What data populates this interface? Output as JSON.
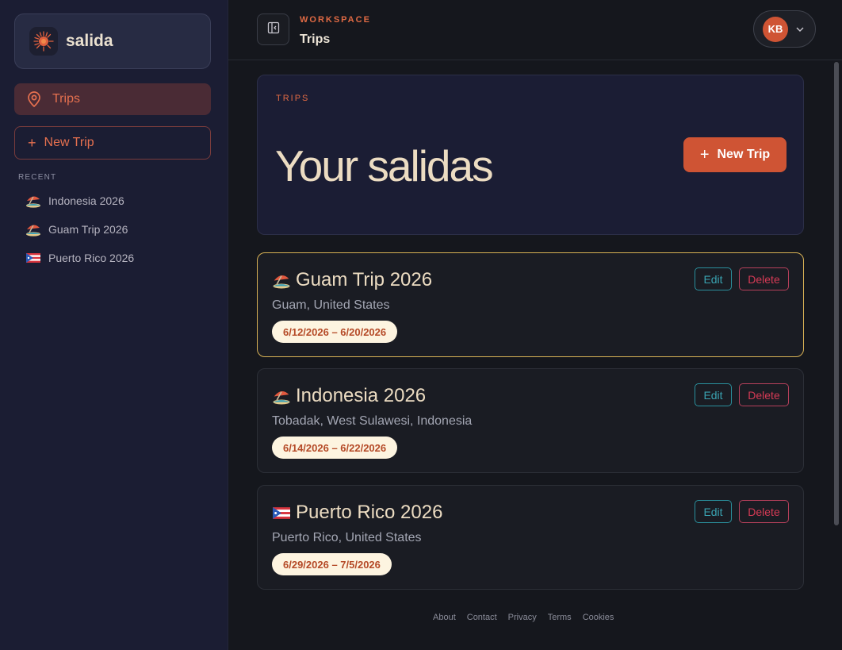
{
  "brand": {
    "name": "salida"
  },
  "sidebar": {
    "nav_trips_label": "Trips",
    "new_trip_label": "New Trip",
    "recent_label": "RECENT",
    "recent": [
      {
        "label": "Indonesia 2026",
        "icon": "beach-umbrella-icon"
      },
      {
        "label": "Guam Trip 2026",
        "icon": "beach-umbrella-icon"
      },
      {
        "label": "Puerto Rico 2026",
        "icon": "puerto-rico-flag-icon"
      }
    ]
  },
  "topbar": {
    "eyebrow": "WORKSPACE",
    "title": "Trips",
    "user_initials": "KB"
  },
  "hero": {
    "eyebrow": "TRIPS",
    "title": "Your salidas",
    "button_label": "New Trip"
  },
  "trips": [
    {
      "title": "Guam Trip 2026",
      "location": "Guam, United States",
      "dates": "6/12/2026 – 6/20/2026",
      "icon": "beach-umbrella-icon",
      "edit_label": "Edit",
      "delete_label": "Delete",
      "selected": true
    },
    {
      "title": "Indonesia 2026",
      "location": "Tobadak, West Sulawesi, Indonesia",
      "dates": "6/14/2026 – 6/22/2026",
      "icon": "beach-umbrella-icon",
      "edit_label": "Edit",
      "delete_label": "Delete",
      "selected": false
    },
    {
      "title": "Puerto Rico 2026",
      "location": "Puerto Rico, United States",
      "dates": "6/29/2026 – 7/5/2026",
      "icon": "puerto-rico-flag-icon",
      "edit_label": "Edit",
      "delete_label": "Delete",
      "selected": false
    }
  ],
  "footer": {
    "links": [
      "About",
      "Contact",
      "Privacy",
      "Terms",
      "Cookies"
    ]
  },
  "colors": {
    "accent": "#cf5434",
    "selected_border": "#d8b255",
    "edit": "#3aa3b2",
    "delete": "#d53a55"
  }
}
